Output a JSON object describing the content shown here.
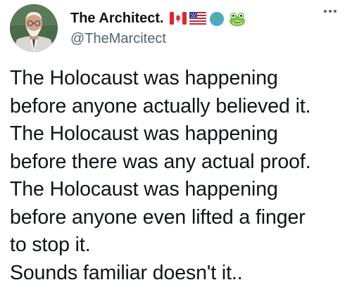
{
  "author": {
    "display_name": "The Architect.",
    "handle": "@TheMarcitect",
    "flag_emojis": [
      "canada-flag-icon",
      "usa-flag-icon",
      "globe-icon",
      "frog-icon"
    ]
  },
  "more_menu": {
    "icon": "more-options-icon"
  },
  "tweet": {
    "lines": [
      "The Holocaust was happening",
      "before anyone actually believed it.",
      "The Holocaust was happening",
      "before there was any actual proof.",
      "The Holocaust was happening",
      "before anyone even lifted a finger",
      "to stop it.",
      "Sounds familiar doesn't it.."
    ]
  },
  "colors": {
    "text": "#0f1419",
    "secondary": "#536471",
    "background": "#ffffff"
  }
}
